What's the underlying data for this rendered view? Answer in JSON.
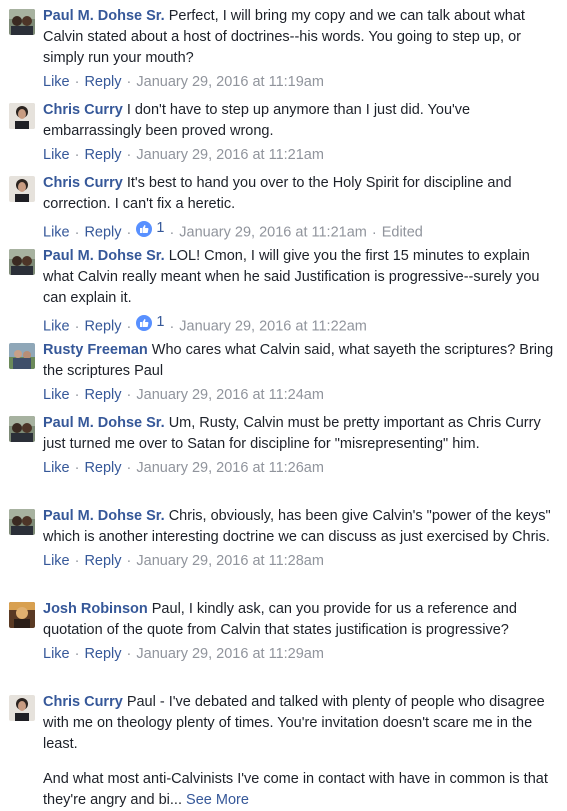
{
  "actions": {
    "like": "Like",
    "reply": "Reply",
    "separator": "·"
  },
  "comments": [
    {
      "author": "Paul M. Dohse Sr.",
      "text": "Perfect, I will bring my copy and we can talk about what Calvin stated about a host of doctrines--his words. You going to step up, or simply run your mouth?",
      "time": "January 29, 2016 at 11:19am"
    },
    {
      "author": "Chris Curry",
      "text": "I don't have to step up anymore than I just did. You've embarrassingly been proved wrong.",
      "time": "January 29, 2016 at 11:21am"
    },
    {
      "author": "Chris Curry",
      "text": "It's best to hand you over to the Holy Spirit for discipline and correction. I can't fix a heretic.",
      "likes": "1",
      "time": "January 29, 2016 at 11:21am",
      "edited": "Edited"
    },
    {
      "author": "Paul M. Dohse Sr.",
      "text": "LOL! Cmon, I will give you the first 15 minutes to explain what Calvin really meant when he said Justification is progressive--surely you can explain it.",
      "likes": "1",
      "time": "January 29, 2016 at 11:22am"
    },
    {
      "author": "Rusty Freeman",
      "text": "Who cares what Calvin said, what sayeth the scriptures? Bring the scriptures Paul",
      "time": "January 29, 2016 at 11:24am"
    },
    {
      "author": "Paul M. Dohse Sr.",
      "text": "Um, Rusty, Calvin must be pretty important as Chris Curry just turned me over to Satan for discipline for \"misrepresenting\" him.",
      "time": "January 29, 2016 at 11:26am"
    },
    {
      "author": "Paul M. Dohse Sr.",
      "text": "Chris, obviously, has been give Calvin's \"power of the keys\" which is another interesting doctrine we can discuss as just exercised by Chris.",
      "time": "January 29, 2016 at 11:28am"
    },
    {
      "author": "Josh Robinson",
      "text": "Paul, I kindly ask, can you provide for us a reference and quotation of the quote from Calvin that states justification is progressive?",
      "time": "January 29, 2016 at 11:29am"
    },
    {
      "author": "Chris Curry",
      "text": "Paul - I've debated and talked with plenty of people who disagree with me on theology plenty of times. You're invitation doesn't scare me in the least.",
      "text2": "And what most anti-Calvinists I've come in contact with have in common is that they're angry and bi...",
      "see_more": "See More"
    }
  ],
  "colors": {
    "link": "#365899",
    "meta": "#90949c",
    "text": "#1d2129",
    "like_badge": "#5890ff"
  }
}
